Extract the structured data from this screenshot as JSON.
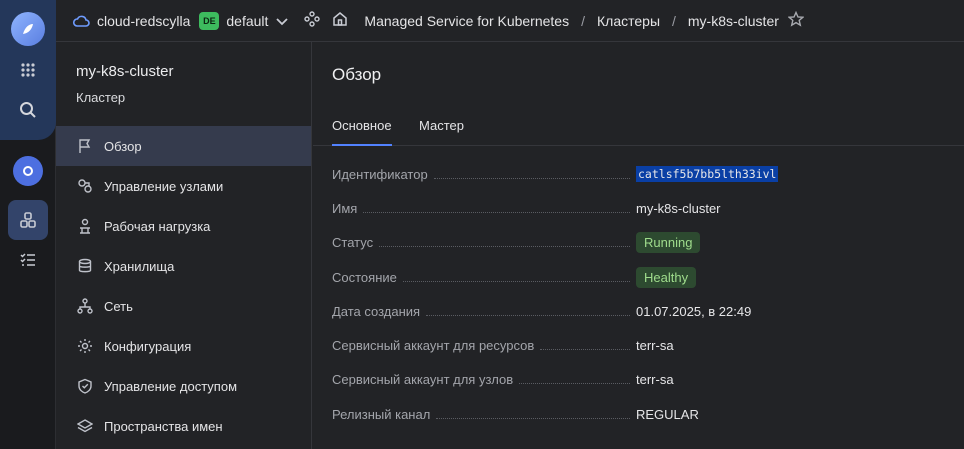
{
  "topbar": {
    "cloud": "cloud-redscylla",
    "folder_badge": "DE",
    "folder": "default",
    "service": "Managed Service for Kubernetes",
    "separator": "/",
    "section": "Кластеры",
    "cluster": "my-k8s-cluster"
  },
  "sidebar": {
    "title": "my-k8s-cluster",
    "subtitle": "Кластер",
    "items": [
      {
        "label": "Обзор",
        "icon": "flag-icon"
      },
      {
        "label": "Управление узлами",
        "icon": "nodes-icon"
      },
      {
        "label": "Рабочая нагрузка",
        "icon": "workload-icon"
      },
      {
        "label": "Хранилища",
        "icon": "storage-icon"
      },
      {
        "label": "Сеть",
        "icon": "network-icon"
      },
      {
        "label": "Конфигурация",
        "icon": "gear-icon"
      },
      {
        "label": "Управление доступом",
        "icon": "shield-icon"
      },
      {
        "label": "Пространства имен",
        "icon": "layers-icon"
      }
    ]
  },
  "main": {
    "title": "Обзор",
    "tabs": [
      {
        "label": "Основное"
      },
      {
        "label": "Мастер"
      }
    ],
    "rows": [
      {
        "label": "Идентификатор",
        "value": "catlsf5b7bb5lth33ivl"
      },
      {
        "label": "Имя",
        "value": "my-k8s-cluster"
      },
      {
        "label": "Статус",
        "value": "Running"
      },
      {
        "label": "Состояние",
        "value": "Healthy"
      },
      {
        "label": "Дата создания",
        "value": "01.07.2025, в 22:49"
      },
      {
        "label": "Сервисный аккаунт для ресурсов",
        "value": "terr-sa"
      },
      {
        "label": "Сервисный аккаунт для узлов",
        "value": "terr-sa"
      },
      {
        "label": "Релизный канал",
        "value": "REGULAR"
      }
    ]
  },
  "colors": {
    "accent": "#5282ff",
    "link": "#6f9cff",
    "status_green": "#9fdc8c",
    "selection": "#0a3fa5"
  }
}
